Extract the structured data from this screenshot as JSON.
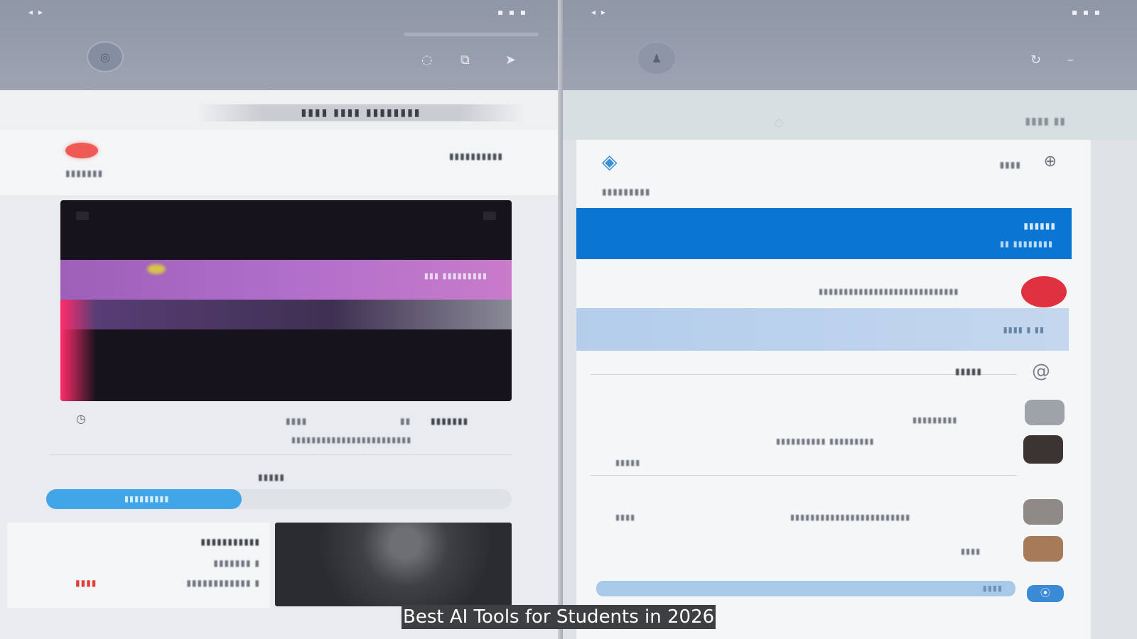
{
  "caption": "Best AI Tools for Students in 2026",
  "left": {
    "status": {
      "left": "◂ ▸",
      "right": "▪ ▪ ▪"
    },
    "header": {
      "profile_icon": "camera-icon",
      "actions": [
        "chat-icon",
        "copy-icon",
        "send-icon"
      ]
    },
    "strip_title": "▮▮▮▮ ▮▮▮▮ ▮▮▮▮▮▮▮▮",
    "post": {
      "author": "▮▮▮▮▮▮▮",
      "meta": "▮▮▮▮▮▮▮▮▮▮",
      "video_overlay": "▮▮▮ ▮▮▮▮▮▮▮▮▮",
      "stats": [
        "▮▮▮▮",
        "▮▮",
        "▮▮▮▮▮▮▮"
      ],
      "stats_sub": "▮▮▮▮▮▮▮▮▮▮▮▮▮▮▮▮▮▮▮▮▮▮▮▮"
    },
    "progress": {
      "label": "▮▮▮▮▮",
      "bar_text": "▮▮▮▮▮▮▮▮▮",
      "value_percent": 42
    },
    "lower_card": {
      "lines": [
        "▮▮▮▮▮▮▮▮▮▮▮",
        "▮▮▮▮▮▮▮ ▮",
        "▮▮▮▮▮▮▮▮▮▮▮▮ ▮"
      ],
      "tag": "▮▮▮▮"
    }
  },
  "right": {
    "status": {
      "left": "◂ ▸",
      "right": "▪ ▪ ▪"
    },
    "header": {
      "profile_icon": "person-icon",
      "actions": [
        "refresh-icon",
        "menu-icon"
      ]
    },
    "strip_title": "▮▮▮▮ ▮▮",
    "card": {
      "author": "▮▮▮▮▮▮▮▮▮",
      "corner": "▮▮▮▮",
      "banner_lines": [
        "▮▮▮▮▮▮",
        "▮▮ ▮▮▮▮▮▮▮▮"
      ],
      "item_text": "▮▮▮▮▮▮▮▮▮▮▮▮▮▮▮▮▮▮▮▮▮▮▮▮▮▮▮▮",
      "light_text": "▮▮▮▮ ▮ ▮▮",
      "section_label": "▮▮▮▮▮",
      "rows": [
        {
          "text": "▮▮▮▮▮▮▮▮▮",
          "sub": ""
        },
        {
          "text": "▮▮▮▮▮▮▮▮▮▮ ▮▮▮▮▮▮▮▮▮",
          "sub": "▮▮▮▮▮"
        },
        {
          "text": "▮▮▮▮▮▮▮▮▮▮▮▮▮▮▮▮▮▮▮▮▮▮▮▮",
          "sub": "▮▮▮▮"
        },
        {
          "text": "▮▮▮▮",
          "sub": ""
        }
      ],
      "bottom_link": "▮▮▮▮"
    }
  }
}
